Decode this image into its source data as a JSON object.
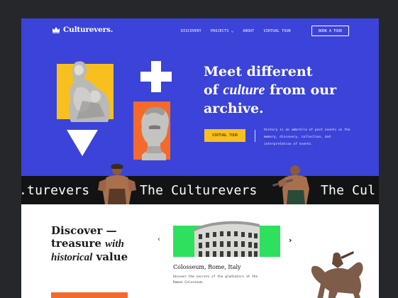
{
  "header": {
    "brand": "Culturevers.",
    "nav": [
      {
        "label": "DISCOVERY"
      },
      {
        "label": "PROJECTS",
        "chevron": "chevron-down-icon"
      },
      {
        "label": "ABOUT"
      },
      {
        "label": "VIRTUAL TOUR"
      }
    ],
    "cta": "BOOK A TOUR"
  },
  "hero": {
    "headline_line1": "Meet different",
    "headline_of": "of",
    "headline_culture": "culture",
    "headline_rest": "from our",
    "headline_line3": "archive.",
    "cta": "VIRTUAL TOUR",
    "description": "History is an umbrella of past events as the memory, discovery, collection, and interpretation of events."
  },
  "marquee": {
    "left": ".turevers",
    "middle": "The Culturevers",
    "right": "The Cul"
  },
  "discover": {
    "title_line1": "Discover —",
    "title_line2a": "treasure",
    "title_line2b": "with",
    "title_line3a": "historical",
    "title_line3b": "value"
  },
  "card": {
    "title": "Colosseum, Rome, Italy",
    "description": "Uncover the secrets of the gladiators at the Roman Colosseum."
  },
  "colors": {
    "hero_bg": "#3b43d8",
    "yellow": "#f8c01f",
    "orange": "#f46a2c",
    "green": "#2fe05f",
    "marquee_bg": "#121315"
  }
}
